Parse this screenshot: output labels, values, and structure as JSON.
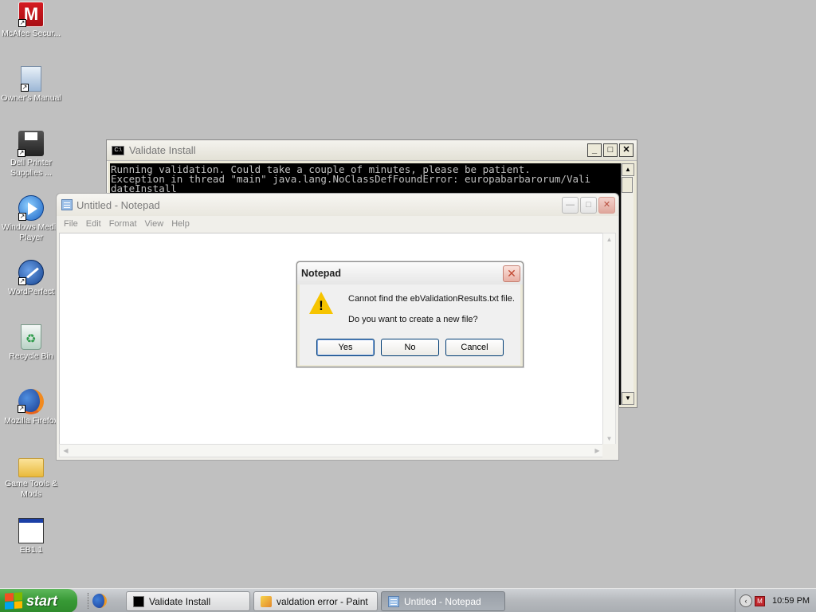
{
  "desktop": {
    "icons": [
      {
        "label": "McAfee Secur...",
        "icon": "mcafee-icon"
      },
      {
        "label": "Owner's Manual",
        "icon": "manual-icon"
      },
      {
        "label": "Dell Printer Supplies ...",
        "icon": "printer-icon"
      },
      {
        "label": "Windows Media Player",
        "icon": "media-player-icon"
      },
      {
        "label": "WordPerfect",
        "icon": "wordperfect-icon"
      },
      {
        "label": "Recycle Bin",
        "icon": "recycle-bin-icon"
      },
      {
        "label": "Mozilla Firefox",
        "icon": "firefox-icon"
      },
      {
        "label": "Game Tools & Mods",
        "icon": "folder-icon"
      },
      {
        "label": "EB1.1",
        "icon": "program-icon"
      }
    ]
  },
  "console": {
    "title": "Validate Install",
    "lines": [
      "Running validation. Could take a couple of minutes, please be patient.",
      "Exception in thread \"main\" java.lang.NoClassDefFoundError: europabarbarorum/Vali",
      "dateInstall"
    ]
  },
  "notepad": {
    "title": "Untitled - Notepad",
    "menu": [
      "File",
      "Edit",
      "Format",
      "View",
      "Help"
    ]
  },
  "dialog": {
    "title": "Notepad",
    "message1": "Cannot find the ebValidationResults.txt file.",
    "message2": "Do you want to create a new file?",
    "buttons": [
      "Yes",
      "No",
      "Cancel"
    ]
  },
  "taskbar": {
    "start_label": "start",
    "tasks": [
      "Validate Install",
      "valdation error - Paint",
      "Untitled - Notepad"
    ],
    "clock": "10:59 PM"
  },
  "colors": {
    "desktop": "#c0c0c0",
    "console_bg": "#000000",
    "start_green": "#379935"
  }
}
